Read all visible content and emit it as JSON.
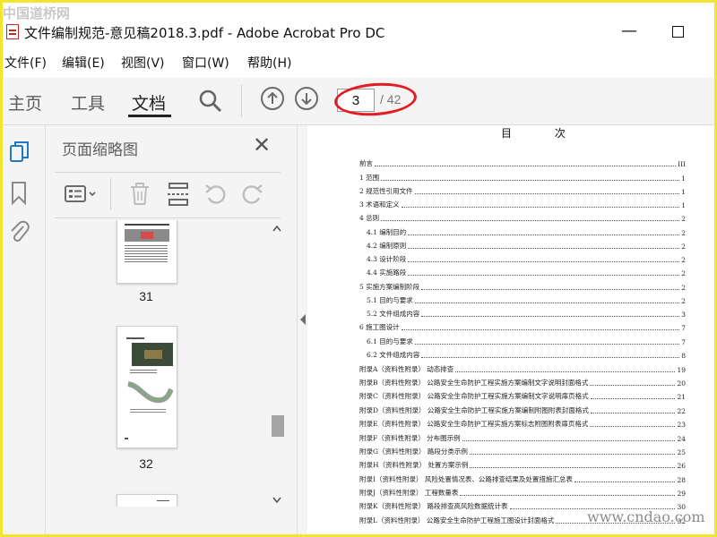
{
  "watermarks": {
    "top_left": "中国道桥网",
    "bottom_right": "www.cndao.com"
  },
  "window": {
    "title": "文件编制规范-意见稿2018.3.pdf - Adobe Acrobat Pro DC"
  },
  "menu": [
    "文件(F)",
    "编辑(E)",
    "视图(V)",
    "窗口(W)",
    "帮助(H)"
  ],
  "tabs": [
    "主页",
    "工具",
    "文档"
  ],
  "active_tab": "文档",
  "nav": {
    "current_page": "3",
    "total_pages": "/ 42"
  },
  "thumbnails": {
    "title": "页面缩略图",
    "pages": [
      "31",
      "32"
    ]
  },
  "left_rail_icons": [
    "page-thumbnails-icon",
    "bookmark-icon",
    "attachment-icon"
  ],
  "colors": {
    "accent": "#1e78c8",
    "annotation": "#e31b23",
    "frame": "#f2e52e"
  },
  "document": {
    "heading": "目 次",
    "toc": [
      {
        "t": "前言",
        "p": "III",
        "lvl": 0
      },
      {
        "t": "1  范围",
        "p": "1",
        "lvl": 0
      },
      {
        "t": "2  规范性引用文件",
        "p": "1",
        "lvl": 0
      },
      {
        "t": "3  术语和定义",
        "p": "1",
        "lvl": 0
      },
      {
        "t": "4  总则",
        "p": "2",
        "lvl": 0
      },
      {
        "t": "4.1  编制目的",
        "p": "2",
        "lvl": 1
      },
      {
        "t": "4.2  编制原则",
        "p": "2",
        "lvl": 1
      },
      {
        "t": "4.3  设计阶段",
        "p": "2",
        "lvl": 1
      },
      {
        "t": "4.4  实施路段",
        "p": "2",
        "lvl": 1
      },
      {
        "t": "5  实施方案编制阶段",
        "p": "2",
        "lvl": 0
      },
      {
        "t": "5.1  目的与要求",
        "p": "2",
        "lvl": 1
      },
      {
        "t": "5.2  文件组成内容",
        "p": "3",
        "lvl": 1
      },
      {
        "t": "6  施工图设计",
        "p": "7",
        "lvl": 0
      },
      {
        "t": "6.1  目的与要求",
        "p": "7",
        "lvl": 1
      },
      {
        "t": "6.2  文件组成内容",
        "p": "8",
        "lvl": 1
      },
      {
        "t": "附录A（资料性附录）   动态排查",
        "p": "19",
        "lvl": 0
      },
      {
        "t": "附录B（资料性附录）   公路安全生命防护工程实施方案编制文字说明封面格式",
        "p": "20",
        "lvl": 0
      },
      {
        "t": "附录C（资料性附录）   公路安全生命防护工程实施方案编制文字说明扉页格式",
        "p": "21",
        "lvl": 0
      },
      {
        "t": "附录D（资料性附录）   公路安全生命防护工程实施方案编制附图附表封面格式",
        "p": "22",
        "lvl": 0
      },
      {
        "t": "附录E（资料性附录）   公路安全生命防护工程实施方案标志附图附表扉页格式",
        "p": "23",
        "lvl": 0
      },
      {
        "t": "附录F（资料性附录）   分布图示例",
        "p": "24",
        "lvl": 0
      },
      {
        "t": "附录G（资料性附录）   路段分类示例",
        "p": "25",
        "lvl": 0
      },
      {
        "t": "附录H（资料性附录）   处置方案示例",
        "p": "26",
        "lvl": 0
      },
      {
        "t": "附录I（资料性附录）   风险处置情况表、公路排查结果及处置措施汇总表",
        "p": "28",
        "lvl": 0
      },
      {
        "t": "附录J（资料性附录）   工程数量表",
        "p": "29",
        "lvl": 0
      },
      {
        "t": "附录K（资料性附录）   路段排查高风险数据统计表",
        "p": "30",
        "lvl": 0
      },
      {
        "t": "附录L（资料性附录）   公路安全生命防护工程施工图设计封面格式",
        "p": "32",
        "lvl": 0
      }
    ]
  }
}
